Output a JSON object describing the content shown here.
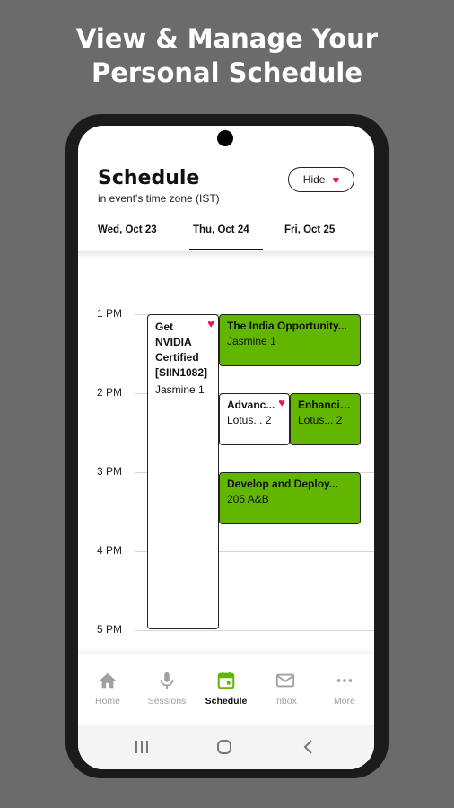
{
  "promo": {
    "line1": "View & Manage Your",
    "line2": "Personal Schedule"
  },
  "header": {
    "title": "Schedule",
    "subtitle": "in event's time zone (IST)",
    "hide_label": "Hide"
  },
  "tabs": [
    {
      "label": "Wed, Oct 23",
      "active": false
    },
    {
      "label": "Thu, Oct 24",
      "active": true
    },
    {
      "label": "Fri, Oct 25",
      "active": false
    }
  ],
  "time_labels": [
    "1 PM",
    "2 PM",
    "3 PM",
    "4 PM",
    "5 PM"
  ],
  "events": [
    {
      "title": "Get NVIDIA Certified [SIIN1082]",
      "location": "Jasmine 1",
      "favorited": true,
      "color": "white"
    },
    {
      "title": "The India Opportunity...",
      "location": "Jasmine 1",
      "favorited": false,
      "color": "green"
    },
    {
      "title": "Advanc...",
      "location": "Lotus... 2",
      "favorited": true,
      "color": "white"
    },
    {
      "title": "Enhancing",
      "location": "Lotus... 2",
      "favorited": false,
      "color": "green"
    },
    {
      "title": "Develop and Deploy...",
      "location": "205 A&B",
      "favorited": false,
      "color": "green"
    }
  ],
  "nav": [
    {
      "label": "Home",
      "icon": "home-icon",
      "active": false
    },
    {
      "label": "Sessions",
      "icon": "microphone-icon",
      "active": false
    },
    {
      "label": "Schedule",
      "icon": "calendar-icon",
      "active": true
    },
    {
      "label": "Inbox",
      "icon": "mail-icon",
      "active": false
    },
    {
      "label": "More",
      "icon": "more-icon",
      "active": false
    }
  ],
  "colors": {
    "accent_green": "#62b600",
    "heart_pink": "#e8155a",
    "background": "#6b6b6b"
  },
  "system_nav": {
    "recents_icon": "recents-icon",
    "home_icon": "circle-home-icon",
    "back_icon": "back-icon"
  }
}
